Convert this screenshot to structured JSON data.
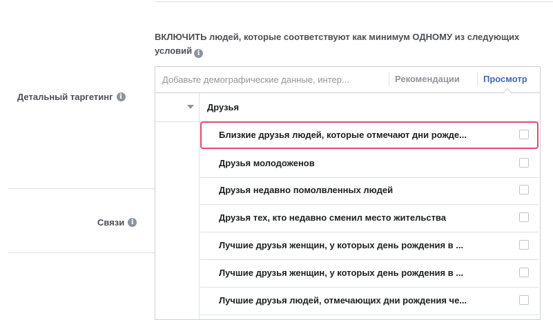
{
  "include_condition": {
    "text": "ВКЛЮЧИТЬ людей, которые соответствуют как минимум ОДНОМУ из следующих условий"
  },
  "labels": {
    "detailed_targeting": "Детальный таргетинг",
    "connections": "Связи"
  },
  "search": {
    "value": "",
    "placeholder": "Добавьте демографические данные, интер...",
    "recommendations_tab": "Рекомендации",
    "browse_tab": "Просмотр"
  },
  "dropdown": {
    "category": "Друзья",
    "items": [
      {
        "label": "Близкие друзья людей, которые отмечают дни рожде...",
        "checked": false,
        "highlighted": true
      },
      {
        "label": "Друзья молодоженов",
        "checked": false
      },
      {
        "label": "Друзья недавно помолвленных людей",
        "checked": false
      },
      {
        "label": "Друзья тех, кто недавно сменил место жительства",
        "checked": false
      },
      {
        "label": "Лучшие друзья женщин, у которых день рождения в ...",
        "checked": false
      },
      {
        "label": "Лучшие друзья женщин, у которых день рождения в ...",
        "checked": false
      },
      {
        "label": "Лучшие друзья людей, отмечающих дни рождения че...",
        "checked": false
      }
    ]
  },
  "colors": {
    "accent": "#4267b2",
    "highlight_border": "#e0486c",
    "label_text": "#4b4f56",
    "divider": "#dddfe2"
  },
  "icons": {
    "info": "info-circle-icon",
    "expand": "triangle-down-icon",
    "checkbox": "checkbox-unchecked-icon"
  }
}
